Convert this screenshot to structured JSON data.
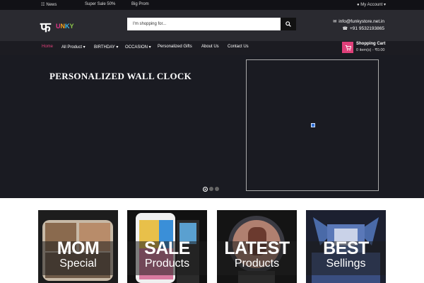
{
  "topbar": {
    "news": "News",
    "sale": "Super Sale 50%",
    "promo": "Big Prom",
    "account": "My Account"
  },
  "header": {
    "logo_mark": "फ",
    "logo_word": [
      "U",
      "N",
      "K",
      "Y"
    ],
    "search_placeholder": "I'm shopping for...",
    "email": "info@funkystore.net.in",
    "phone": "+91 9532193865"
  },
  "nav": {
    "items": [
      "Home",
      "All Product",
      "BIRTHDAY",
      "OCCASION",
      "Personalized Gifts",
      "About Us",
      "Contact Us"
    ],
    "active": "Home"
  },
  "cart": {
    "title": "Shopping Cart",
    "summary": "0 item(s) - ₹0.00"
  },
  "hero": {
    "title": "PERSONALIZED WALL CLOCK"
  },
  "tiles": [
    {
      "big": "MOM",
      "small": "Special"
    },
    {
      "big": "SALE",
      "small": "Products"
    },
    {
      "big": "LATEST",
      "small": "Products"
    },
    {
      "big": "BEST",
      "small": "Sellings"
    }
  ],
  "colors": {
    "accent": "#e0407a",
    "header_bg": "#2a2a30",
    "hero_bg": "#1a1b22"
  }
}
